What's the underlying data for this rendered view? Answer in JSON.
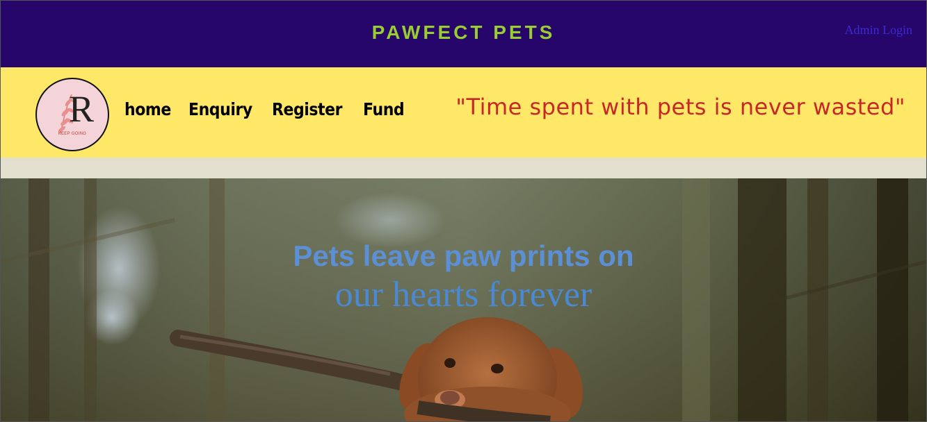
{
  "header": {
    "brand": "PAWFECT PETS",
    "admin_login": "Admin Login"
  },
  "logo": {
    "letter": "R",
    "caption": "KEEP GOING",
    "icon": "leaf-branch-icon"
  },
  "nav": {
    "items": [
      {
        "label": "home"
      },
      {
        "label": "Enquiry"
      },
      {
        "label": "Register"
      },
      {
        "label": "Fund"
      }
    ]
  },
  "quote": "\"Time spent with pets is never wasted\"",
  "hero": {
    "line1": "Pets leave paw prints on",
    "line2": "our hearts forever",
    "image": "dog-with-stick-in-forest"
  },
  "colors": {
    "topbar": "#27066b",
    "brand": "#9acd32",
    "navband": "#ffe867",
    "quote": "#c62828",
    "hero_text": "#5b8fd6"
  }
}
